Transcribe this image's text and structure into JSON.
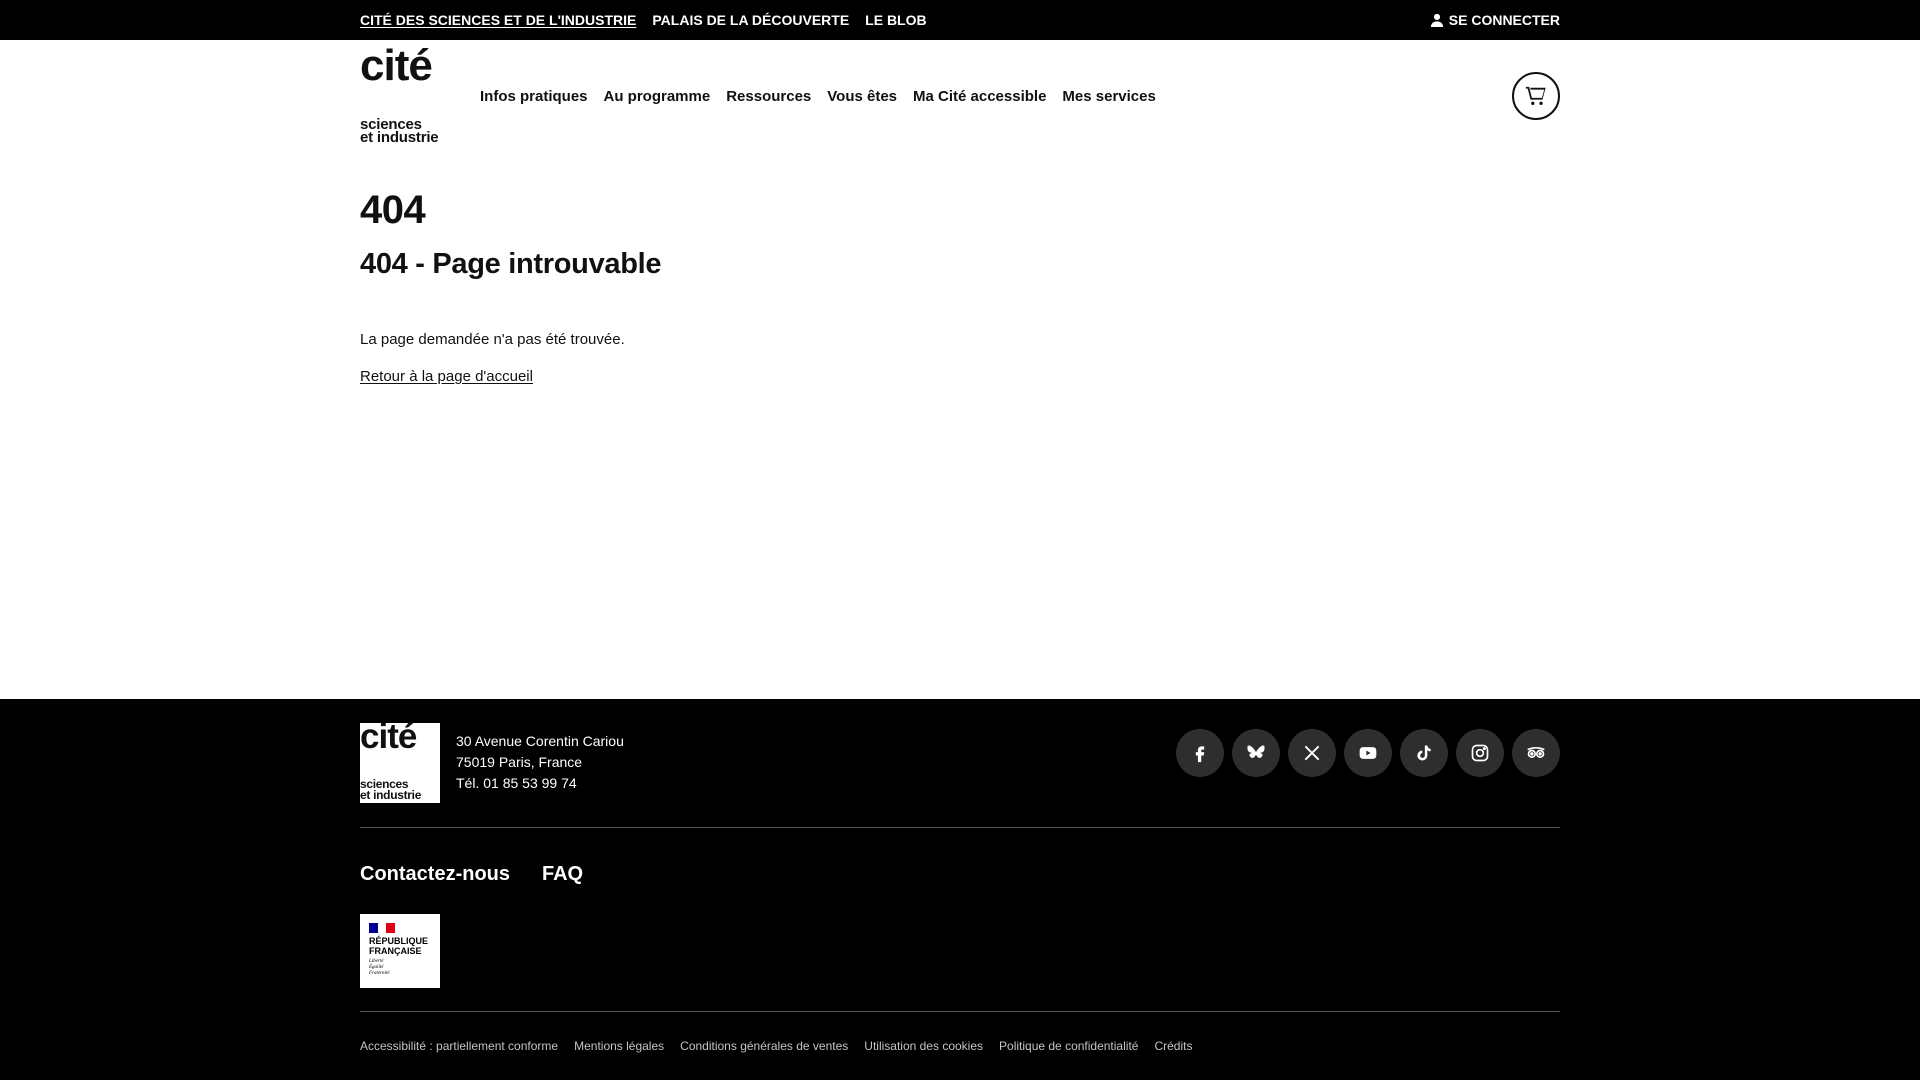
{
  "topbar": {
    "links": [
      {
        "label": "CITÉ DES SCIENCES ET DE L'INDUSTRIE"
      },
      {
        "label": "PALAIS DE LA DÉCOUVERTE"
      },
      {
        "label": "LE BLOB"
      }
    ],
    "login_label": "SE CONNECTER"
  },
  "header": {
    "logo": {
      "line1": "cité",
      "line2": "sciences",
      "line3": "et industrie"
    },
    "nav": [
      {
        "label": "Infos pratiques"
      },
      {
        "label": "Au programme"
      },
      {
        "label": "Ressources"
      },
      {
        "label": "Vous êtes"
      },
      {
        "label": "Ma Cité accessible"
      },
      {
        "label": "Mes services"
      }
    ]
  },
  "main": {
    "title": "404",
    "subtitle": "404 - Page introuvable",
    "message": "La page demandée n'a pas été trouvée.",
    "home_link": "Retour à la page d'accueil"
  },
  "footer": {
    "logo": {
      "line1": "cité",
      "line2": "sciences",
      "line3": "et industrie"
    },
    "address": {
      "street": "30 Avenue Corentin Cariou",
      "city": "75019 Paris, France",
      "phone": "Tél. 01 85 53 99 74"
    },
    "socials": [
      "facebook-icon",
      "bluesky-icon",
      "x-icon",
      "youtube-icon",
      "tiktok-icon",
      "instagram-icon",
      "tripadvisor-icon"
    ],
    "links": [
      {
        "label": "Contactez-nous"
      },
      {
        "label": "FAQ"
      }
    ],
    "republique": {
      "line1": "RÉPUBLIQUE",
      "line2": "FRANÇAISE",
      "motto1": "Liberté",
      "motto2": "Égalité",
      "motto3": "Fraternité"
    },
    "legal": [
      {
        "label": "Accessibilité : partiellement conforme"
      },
      {
        "label": "Mentions légales"
      },
      {
        "label": "Conditions générales de ventes"
      },
      {
        "label": "Utilisation des cookies"
      },
      {
        "label": "Politique de confidentialité"
      },
      {
        "label": "Crédits"
      }
    ]
  },
  "colors": {
    "black": "#000000",
    "social_bg": "#2e2e2e",
    "flag_blue": "#000091",
    "flag_red": "#e1000f"
  }
}
